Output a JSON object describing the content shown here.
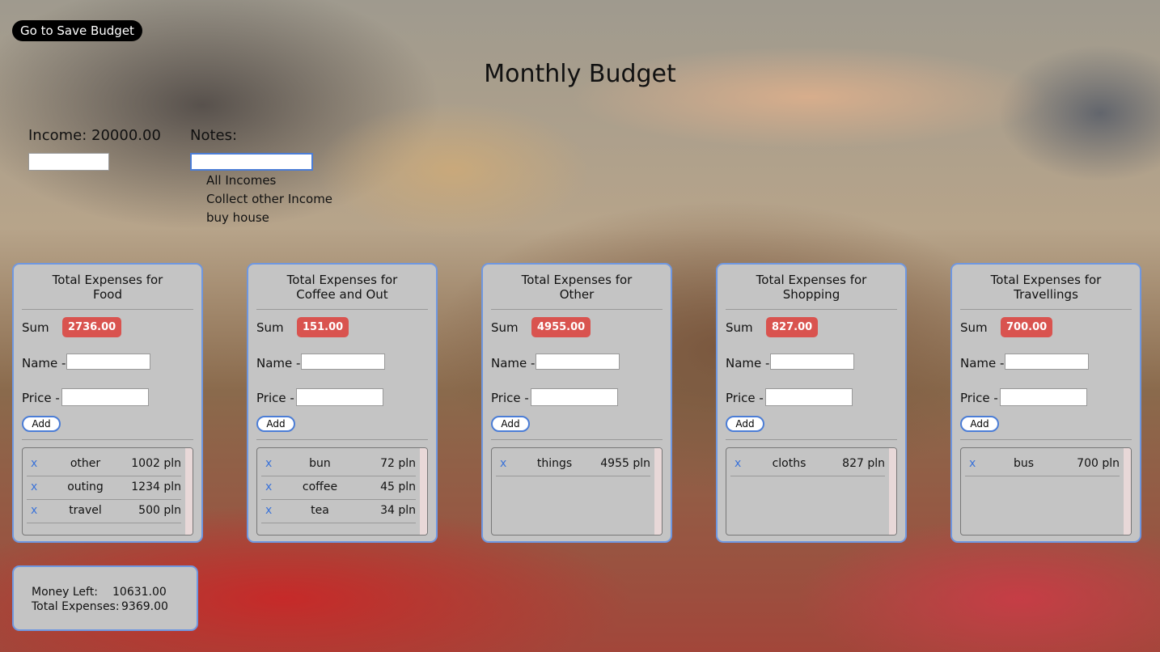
{
  "header": {
    "save_button": "Go to Save Budget",
    "title": "Monthly Budget"
  },
  "income": {
    "label": "Income: 20000.00",
    "input_value": ""
  },
  "notes": {
    "label": "Notes:",
    "input_value": "",
    "items": [
      "All Incomes",
      "Collect other Income",
      "buy house"
    ]
  },
  "labels": {
    "sum": "Sum",
    "name": "Name -",
    "price": "Price -",
    "add": "Add",
    "delete": "x"
  },
  "categories": [
    {
      "title_line1": "Total Expenses for",
      "title_line2": "Food",
      "sum": "2736.00",
      "items": [
        {
          "name": "other",
          "price": "1002 pln"
        },
        {
          "name": "outing",
          "price": "1234 pln"
        },
        {
          "name": "travel",
          "price": "500 pln"
        }
      ]
    },
    {
      "title_line1": "Total Expenses for",
      "title_line2": "Coffee and Out",
      "sum": "151.00",
      "items": [
        {
          "name": "bun",
          "price": "72 pln"
        },
        {
          "name": "coffee",
          "price": "45 pln"
        },
        {
          "name": "tea",
          "price": "34 pln"
        }
      ]
    },
    {
      "title_line1": "Total Expenses for",
      "title_line2": "Other",
      "sum": "4955.00",
      "items": [
        {
          "name": "things",
          "price": "4955 pln"
        }
      ]
    },
    {
      "title_line1": "Total Expenses for",
      "title_line2": "Shopping",
      "sum": "827.00",
      "items": [
        {
          "name": "cloths",
          "price": "827 pln"
        }
      ]
    },
    {
      "title_line1": "Total Expenses for",
      "title_line2": "Travellings",
      "sum": "700.00",
      "items": [
        {
          "name": "bus",
          "price": "700 pln"
        }
      ]
    }
  ],
  "summary": {
    "money_left_label": "Money Left:",
    "money_left": "10631.00",
    "total_expenses_label": "Total Expenses:",
    "total_expenses": "9369.00"
  },
  "colors": {
    "card_border": "#6f97e0",
    "sum_badge": "#d9534f",
    "delete_x": "#3b73d9"
  }
}
